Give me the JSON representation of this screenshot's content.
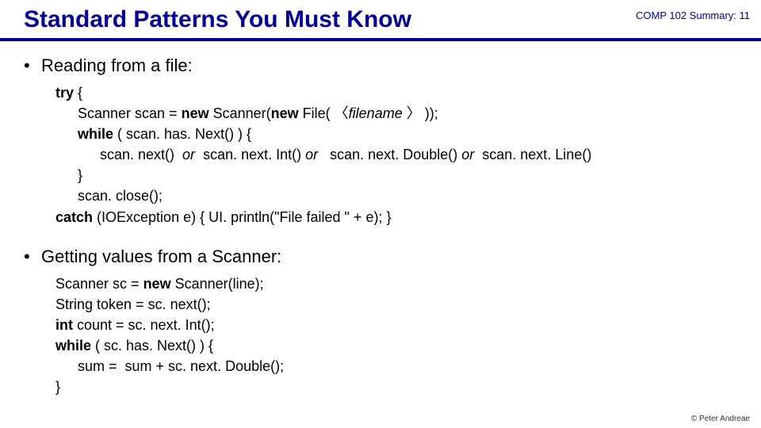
{
  "header": {
    "title": "Standard Patterns You Must Know",
    "course": "COMP 102  Summary: 11"
  },
  "bullets": {
    "b1": "Reading from a file:",
    "b2": "Getting values from a Scanner:"
  },
  "code1": {
    "l1_kw": "try",
    "l1_rest": " {",
    "l2a": "Scanner scan = ",
    "l2_kw1": "new",
    "l2b": " Scanner(",
    "l2_kw2": "new",
    "l2c": " File( 〈",
    "l2_ital": "filename",
    "l2d": " 〉 ));",
    "l3_kw": "while",
    "l3_rest": " ( scan. has. Next() ) {",
    "l4_a": "scan. next()  ",
    "l4_i1": "or",
    "l4_b": "  scan. next. Int() ",
    "l4_i2": "or",
    "l4_c": "   scan. next. Double() ",
    "l4_i3": "or",
    "l4_d": "  scan. next. Line()",
    "l5": "}",
    "l6": "scan. close();",
    "l7_kw": "catch",
    "l7_rest": " (IOException e) { UI. println(\"File failed \" + e); }"
  },
  "code2": {
    "l1a": "Scanner sc = ",
    "l1_kw": "new",
    "l1b": " Scanner(line);",
    "l2": "String token = sc. next();",
    "l3_kw": "int",
    "l3_rest": " count = sc. next. Int();",
    "l4_kw": "while",
    "l4_rest": " ( sc. has. Next() ) {",
    "l5": "sum =  sum + sc. next. Double();",
    "l6": "}"
  },
  "footer": "© Peter Andreae"
}
